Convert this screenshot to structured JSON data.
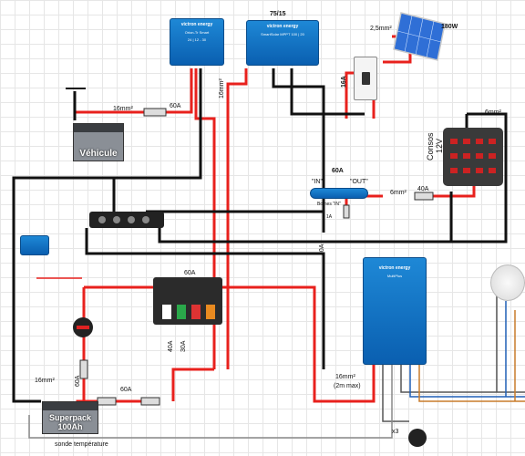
{
  "labels": {
    "mppt_model": "75/15",
    "panel_power": "180W",
    "panel_wire": "2,5mm²",
    "breaker_rating": "16A",
    "vehicle_wire": "16mm²",
    "vehicle_fuse": "60A",
    "dcdc_wire": "16mm²",
    "conso_wire": "6mm²",
    "fuse_60a_mid": "60A",
    "in_label": "\"IN\"",
    "out_label": "\"OUT\"",
    "wire_6mm_b": "6mm²",
    "fuse_40a": "40A",
    "busbar_fuse": "60A",
    "fuse_40a_v": "40A",
    "fuse_30a_v": "30A",
    "batt_wire": "16mm²",
    "batt_fuse": "60A",
    "inverter_40a": "40A",
    "inverter_wire": "16mm²",
    "inverter_wire_note": "(2m max)",
    "temp_sensor": "sonde température",
    "fuse_60a_left": "60A",
    "consos": "Consos",
    "consos_v": "12V",
    "switch_label": "Bornes \"IN\"",
    "fuse_1a": "1A",
    "x3": "x3"
  },
  "devices": {
    "dcdc_brand": "victron energy",
    "dcdc_model": "Orion-Tr Smart",
    "dcdc_spec": "24 | 12 - 30",
    "mppt_brand": "victron energy",
    "mppt_model": "SmartSolar MPPT 100 | 20",
    "vehicle_battery": "Véhicule",
    "aux_battery_line1": "Superpack",
    "aux_battery_line2": "100Ah",
    "inverter_brand": "victron energy",
    "inverter_model": "MultiPlus"
  },
  "colors": {
    "positive": "#e8211d",
    "negative": "#111111",
    "victron_blue": "#1177cc"
  }
}
